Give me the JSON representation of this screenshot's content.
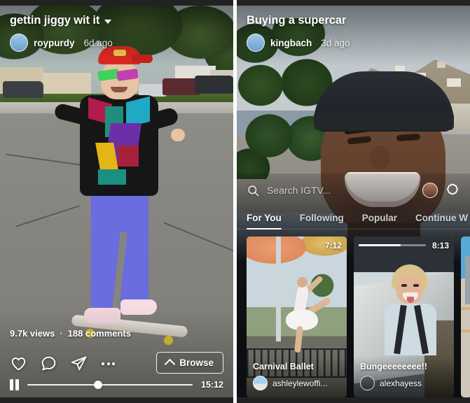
{
  "app": "Instagram IGTV",
  "left_panel": {
    "header": {
      "title": "gettin jiggy wit it",
      "dropdown_icon": "chevron-down-icon",
      "username": "roypurdy",
      "timestamp": "6d ago"
    },
    "stats": {
      "views": "9.7k views",
      "separator": "·",
      "comments": "188 comments"
    },
    "actions": {
      "like_icon": "heart-icon",
      "comment_icon": "comment-bubble-icon",
      "share_icon": "paper-plane-icon",
      "more_icon": "more-dots-icon",
      "browse_label": "Browse",
      "browse_icon": "chevron-up-icon"
    },
    "player": {
      "pause_icon": "pause-icon",
      "progress_percent": 43,
      "duration": "15:12"
    }
  },
  "right_panel": {
    "header": {
      "title": "Buying a supercar",
      "username": "kingbach",
      "timestamp": "3d ago"
    },
    "search": {
      "icon": "search-icon",
      "placeholder": "Search IGTV..."
    },
    "top_actions": {
      "avatar_icon": "profile-avatar-icon",
      "igtv_icon": "igtv-settings-icon"
    },
    "tabs": [
      {
        "label": "For You",
        "active": true
      },
      {
        "label": "Following",
        "active": false
      },
      {
        "label": "Popular",
        "active": false
      },
      {
        "label": "Continue W",
        "active": false
      }
    ],
    "thumbnails": [
      {
        "title": "Carnival Ballet",
        "username": "ashleylewoffi...",
        "duration": "7:12",
        "has_progress": false,
        "progress_percent": 0
      },
      {
        "title": "Bungeeeeeeee!!",
        "username": "alexhayess",
        "duration": "8:13",
        "has_progress": true,
        "progress_percent": 62
      }
    ]
  },
  "colors": {
    "accent_white": "#ffffff",
    "sheet_background": "#0e1013",
    "page_background": "#ffffff"
  }
}
